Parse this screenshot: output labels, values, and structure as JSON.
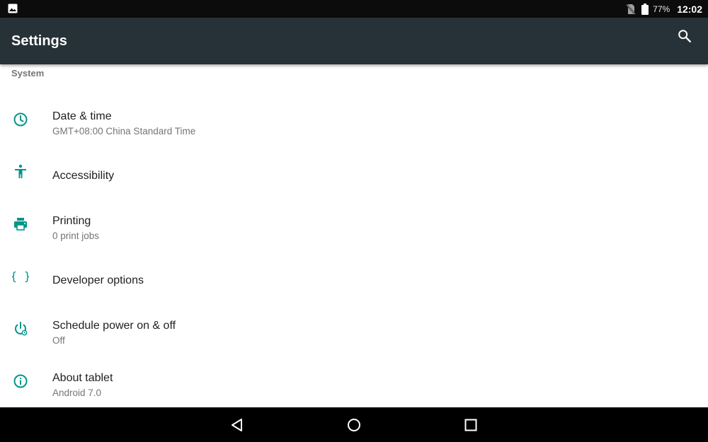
{
  "status_bar": {
    "battery_percent": "77%",
    "time": "12:02",
    "notification_icon": "image-icon",
    "sim_icon": "no-sim-icon",
    "battery_icon": "battery-icon"
  },
  "app_bar": {
    "title": "Settings",
    "search_icon": "search-icon",
    "background": "#263238"
  },
  "section": {
    "header": "System"
  },
  "items": [
    {
      "label": "Date & time",
      "summary": "GMT+08:00 China Standard Time",
      "icon": "clock-icon"
    },
    {
      "label": "Accessibility",
      "summary": "",
      "icon": "accessibility-icon"
    },
    {
      "label": "Printing",
      "summary": "0 print jobs",
      "icon": "print-icon"
    },
    {
      "label": "Developer options",
      "summary": "",
      "icon": "braces-icon"
    },
    {
      "label": "Schedule power on & off",
      "summary": "Off",
      "icon": "power-schedule-icon"
    },
    {
      "label": "About tablet",
      "summary": "Android 7.0",
      "icon": "info-icon"
    }
  ],
  "nav_bar": {
    "back_icon": "back-icon",
    "home_icon": "home-icon",
    "recents_icon": "recents-icon"
  },
  "colors": {
    "accent": "#009688",
    "status_bar": "#0c0c0c",
    "nav_bar": "#000000"
  }
}
